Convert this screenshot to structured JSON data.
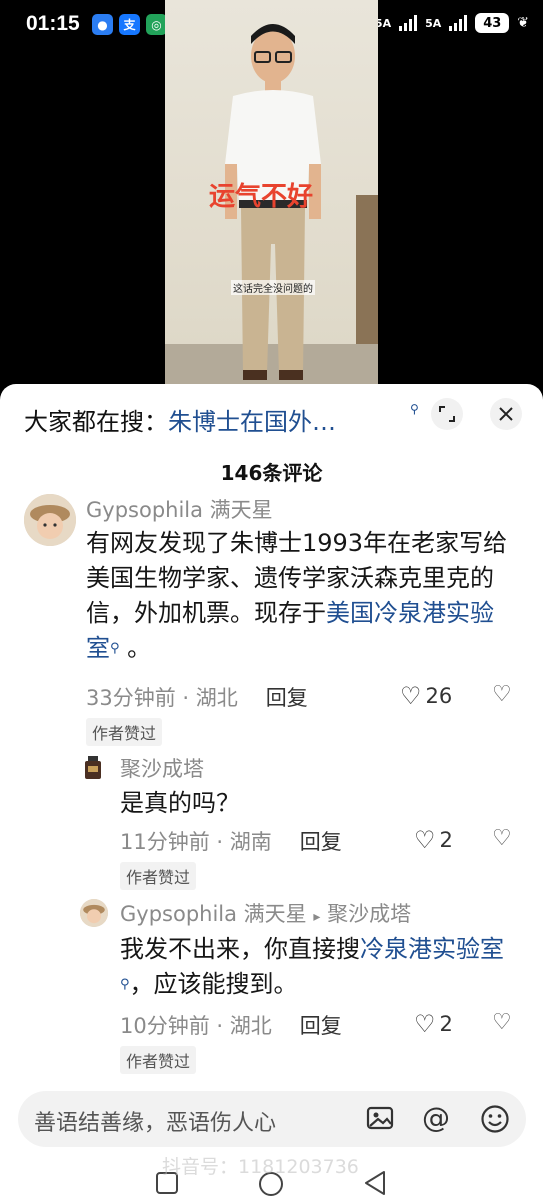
{
  "status_bar": {
    "time": "01:15",
    "app_icons": [
      "message-icon",
      "alipay-icon",
      "app-icon",
      "bulb-icon",
      "voice-icon"
    ],
    "network_1": "5A",
    "network_2": "5A",
    "battery": "43"
  },
  "video": {
    "overlay_title": "运气不好",
    "subtitle": "这话完全没问题的"
  },
  "search": {
    "prefix": "大家都在搜：",
    "query": "朱博士在国外…"
  },
  "comments_header": {
    "count_label": "146条评论"
  },
  "comments": [
    {
      "user": "Gypsophila 满天星",
      "text_part1": "有网友发现了朱博士1993年在老家写给美国生物学家、遗传学家沃森克里克的信，外加机票。现存于",
      "link": "美国冷泉港实验室",
      "text_part2": "。",
      "time": "33分钟前",
      "location": "湖北",
      "reply": "回复",
      "likes": "26",
      "badge": "作者赞过"
    },
    {
      "user": "聚沙成塔",
      "text": "是真的吗？",
      "time": "11分钟前",
      "location": "湖南",
      "reply": "回复",
      "likes": "2",
      "badge": "作者赞过"
    },
    {
      "user": "Gypsophila 满天星",
      "reply_to": "聚沙成塔",
      "text_part1": "我发不出来，你直接搜",
      "link": "冷泉港实验室",
      "text_part2": "，应该能搜到。",
      "time": "10分钟前",
      "location": "湖北",
      "reply": "回复",
      "likes": "2",
      "badge": "作者赞过"
    }
  ],
  "input": {
    "placeholder": "善语结善缘，恶语伤人心"
  },
  "watermark": "抖音号：1181203736",
  "colors": {
    "link": "#204f91",
    "overlay_text": "#e8432e",
    "meta": "#8a8a8a"
  }
}
